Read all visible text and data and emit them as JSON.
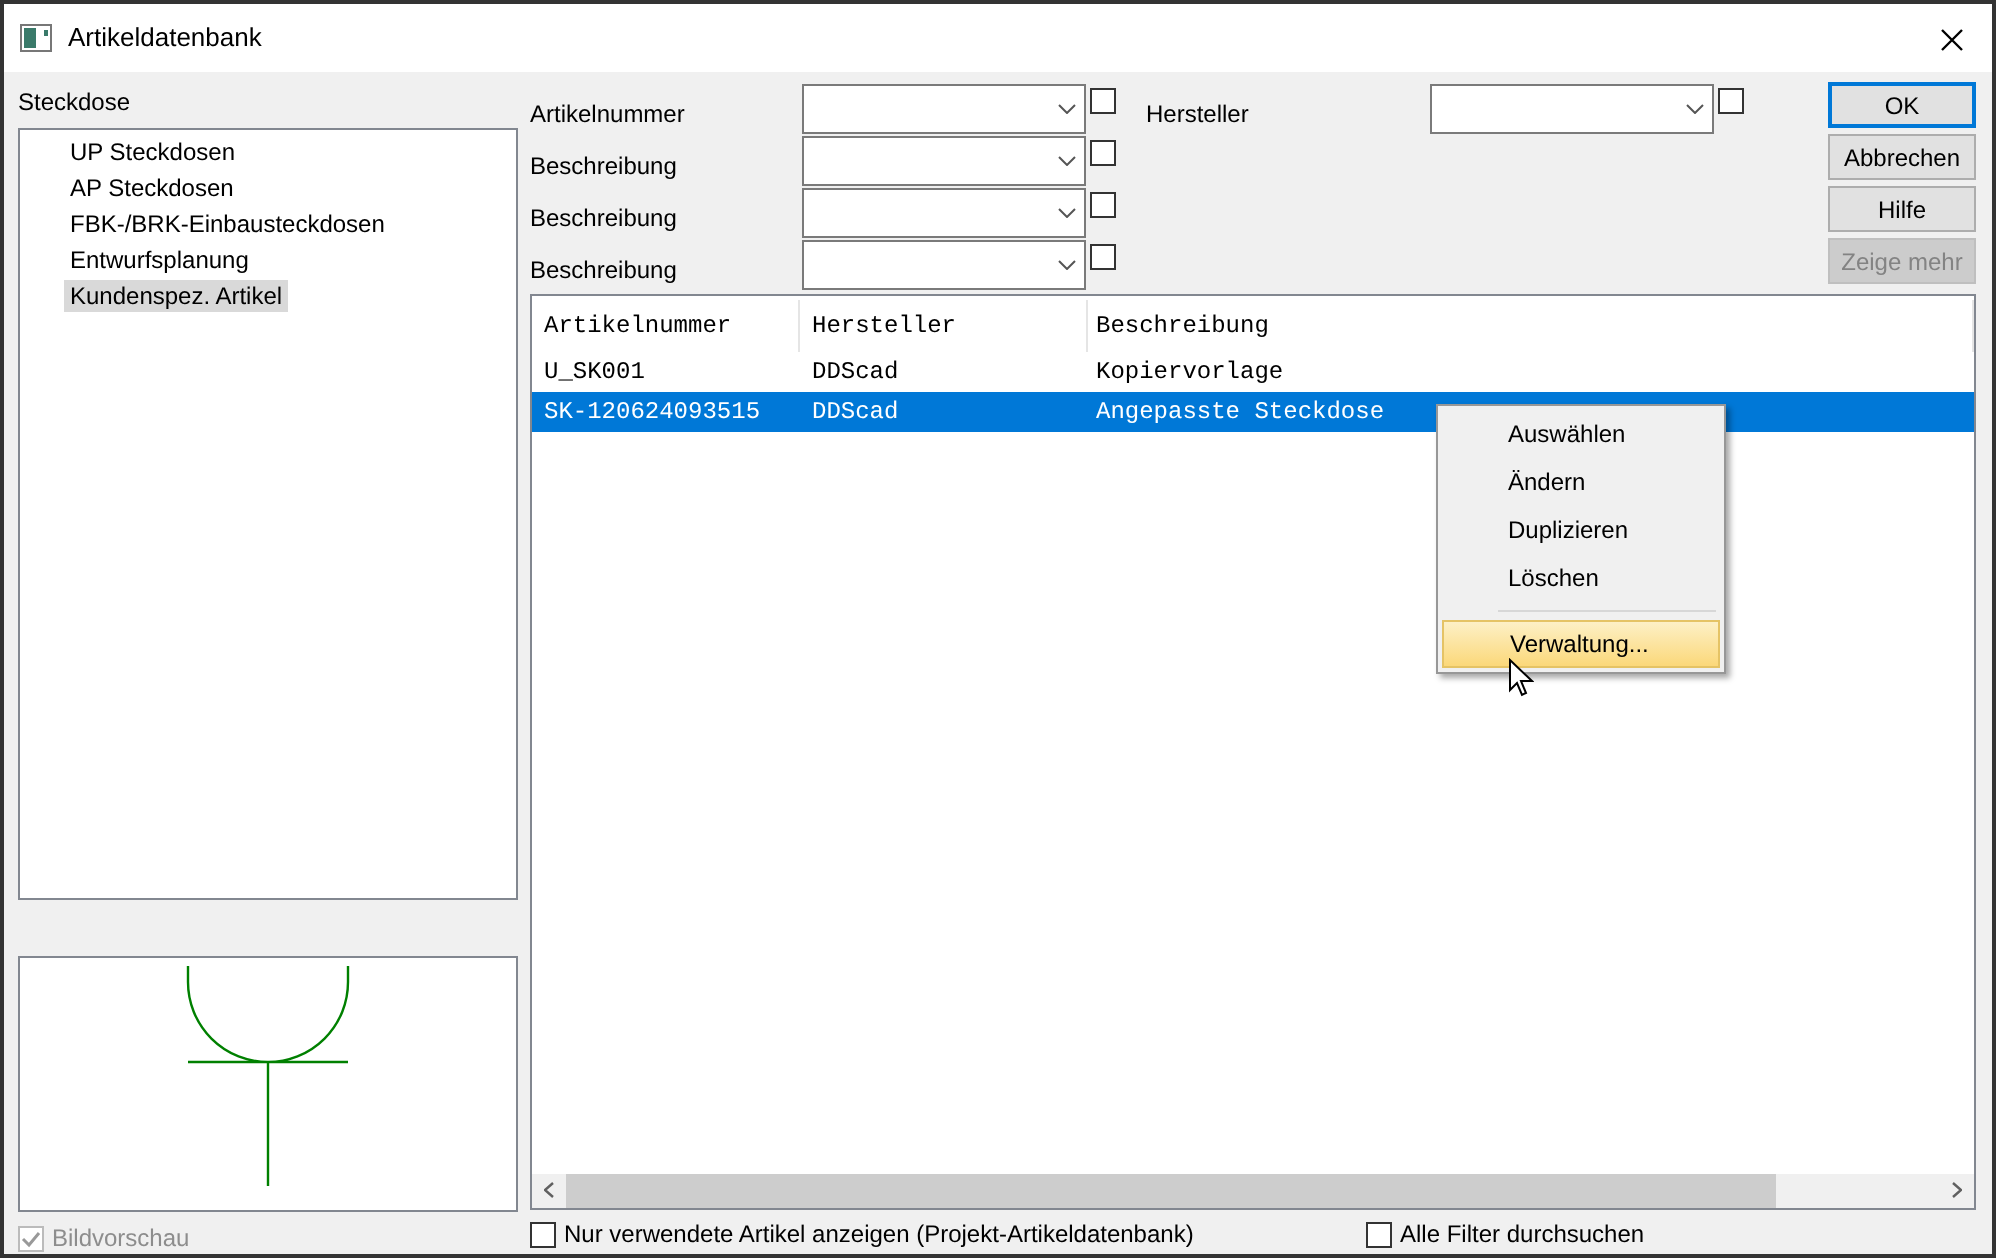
{
  "window": {
    "title": "Artikeldatenbank"
  },
  "category": {
    "label": "Steckdose"
  },
  "tree": {
    "items": [
      {
        "label": "UP Steckdosen",
        "selected": false
      },
      {
        "label": "AP Steckdosen",
        "selected": false
      },
      {
        "label": "FBK-/BRK-Einbausteckdosen",
        "selected": false
      },
      {
        "label": "Entwurfsplanung",
        "selected": false
      },
      {
        "label": "Kundenspez. Artikel",
        "selected": true
      }
    ]
  },
  "preview_option": {
    "label": "Bildvorschau",
    "checked": true,
    "disabled": true
  },
  "filters": [
    {
      "label": "Artikelnummer",
      "checked": false
    },
    {
      "label": "Beschreibung",
      "checked": false
    },
    {
      "label": "Beschreibung",
      "checked": false
    },
    {
      "label": "Beschreibung",
      "checked": false
    }
  ],
  "manufacturer_filter": {
    "label": "Hersteller",
    "checked": false
  },
  "buttons": [
    {
      "label": "OK",
      "default": true,
      "disabled": false
    },
    {
      "label": "Abbrechen",
      "default": false,
      "disabled": false
    },
    {
      "label": "Hilfe",
      "default": false,
      "disabled": false
    },
    {
      "label": "Zeige mehr",
      "default": false,
      "disabled": true
    }
  ],
  "table": {
    "columns": [
      "Artikelnummer",
      "Hersteller",
      "Beschreibung"
    ],
    "rows": [
      {
        "cells": [
          "U_SK001",
          "DDScad",
          "Kopiervorlage"
        ],
        "selected": false
      },
      {
        "cells": [
          "SK-120624093515",
          "DDScad",
          "Angepasste Steckdose"
        ],
        "selected": true
      }
    ]
  },
  "context_menu": {
    "items": [
      {
        "kind": "item",
        "label": "Auswählen",
        "selected": false
      },
      {
        "kind": "item",
        "label": "Ändern",
        "selected": false
      },
      {
        "kind": "item",
        "label": "Duplizieren",
        "selected": false
      },
      {
        "kind": "item",
        "label": "Löschen",
        "selected": false
      },
      {
        "kind": "separator"
      },
      {
        "kind": "item",
        "label": "Verwaltung...",
        "selected": true
      }
    ]
  },
  "footer_options": [
    {
      "label": "Nur verwendete Artikel anzeigen (Projekt-Artikeldatenbank)",
      "checked": false
    },
    {
      "label": "Alle Filter durchsuchen",
      "checked": false
    }
  ]
}
